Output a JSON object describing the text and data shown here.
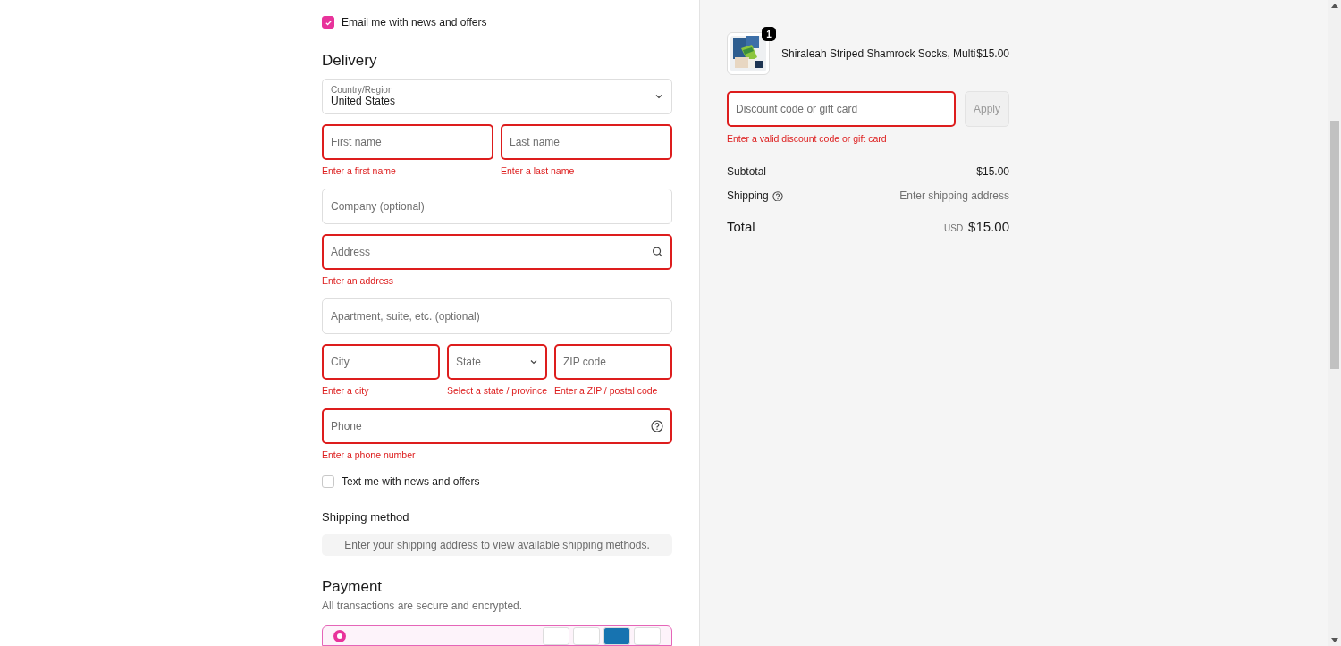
{
  "email_marketing": {
    "label": "Email me with news and offers",
    "checked": true
  },
  "delivery": {
    "heading": "Delivery",
    "rows": [
      [
        {
          "kind": "select",
          "label": "Country/Region",
          "value": "United States",
          "invalid": false
        }
      ],
      [
        {
          "kind": "text",
          "placeholder": "First name",
          "invalid": true,
          "error": "Enter a first name"
        },
        {
          "kind": "text",
          "placeholder": "Last name",
          "invalid": true,
          "error": "Enter a last name"
        }
      ],
      [
        {
          "kind": "text",
          "placeholder": "Company (optional)",
          "invalid": false
        }
      ],
      [
        {
          "kind": "search",
          "placeholder": "Address",
          "invalid": true,
          "error": "Enter an address"
        }
      ],
      [
        {
          "kind": "text",
          "placeholder": "Apartment, suite, etc. (optional)",
          "invalid": false
        }
      ],
      [
        {
          "kind": "text",
          "placeholder": "City",
          "invalid": true,
          "error": "Enter a city"
        },
        {
          "kind": "dropdown",
          "placeholder": "State",
          "invalid": true,
          "error": "Select a state / province"
        },
        {
          "kind": "text",
          "placeholder": "ZIP code",
          "invalid": true,
          "error": "Enter a ZIP / postal code"
        }
      ],
      [
        {
          "kind": "help",
          "placeholder": "Phone",
          "invalid": true,
          "error": "Enter a phone number"
        }
      ]
    ]
  },
  "sms_marketing": {
    "label": "Text me with news and offers",
    "checked": false
  },
  "shipping_method": {
    "heading": "Shipping method",
    "message": "Enter your shipping address to view available shipping methods."
  },
  "payment": {
    "heading": "Payment",
    "subtitle": "All transactions are secure and encrypted.",
    "option": {
      "selected": true
    }
  },
  "order_summary": {
    "items": [
      {
        "name": "Shiraleah Striped Shamrock Socks, Multi",
        "price": "$15.00",
        "quantity": "1"
      }
    ],
    "discount": {
      "placeholder": "Discount code or gift card",
      "invalid": true,
      "error": "Enter a valid discount code or gift card"
    },
    "apply_button": {
      "label": "Apply",
      "disabled": true
    },
    "lines": [
      {
        "label": "Subtotal",
        "value": "$15.00",
        "help": false,
        "muted": false
      },
      {
        "label": "Shipping",
        "value": "Enter shipping address",
        "help": true,
        "muted": true
      }
    ],
    "total": {
      "label": "Total",
      "currency": "USD",
      "amount": "$15.00"
    }
  }
}
